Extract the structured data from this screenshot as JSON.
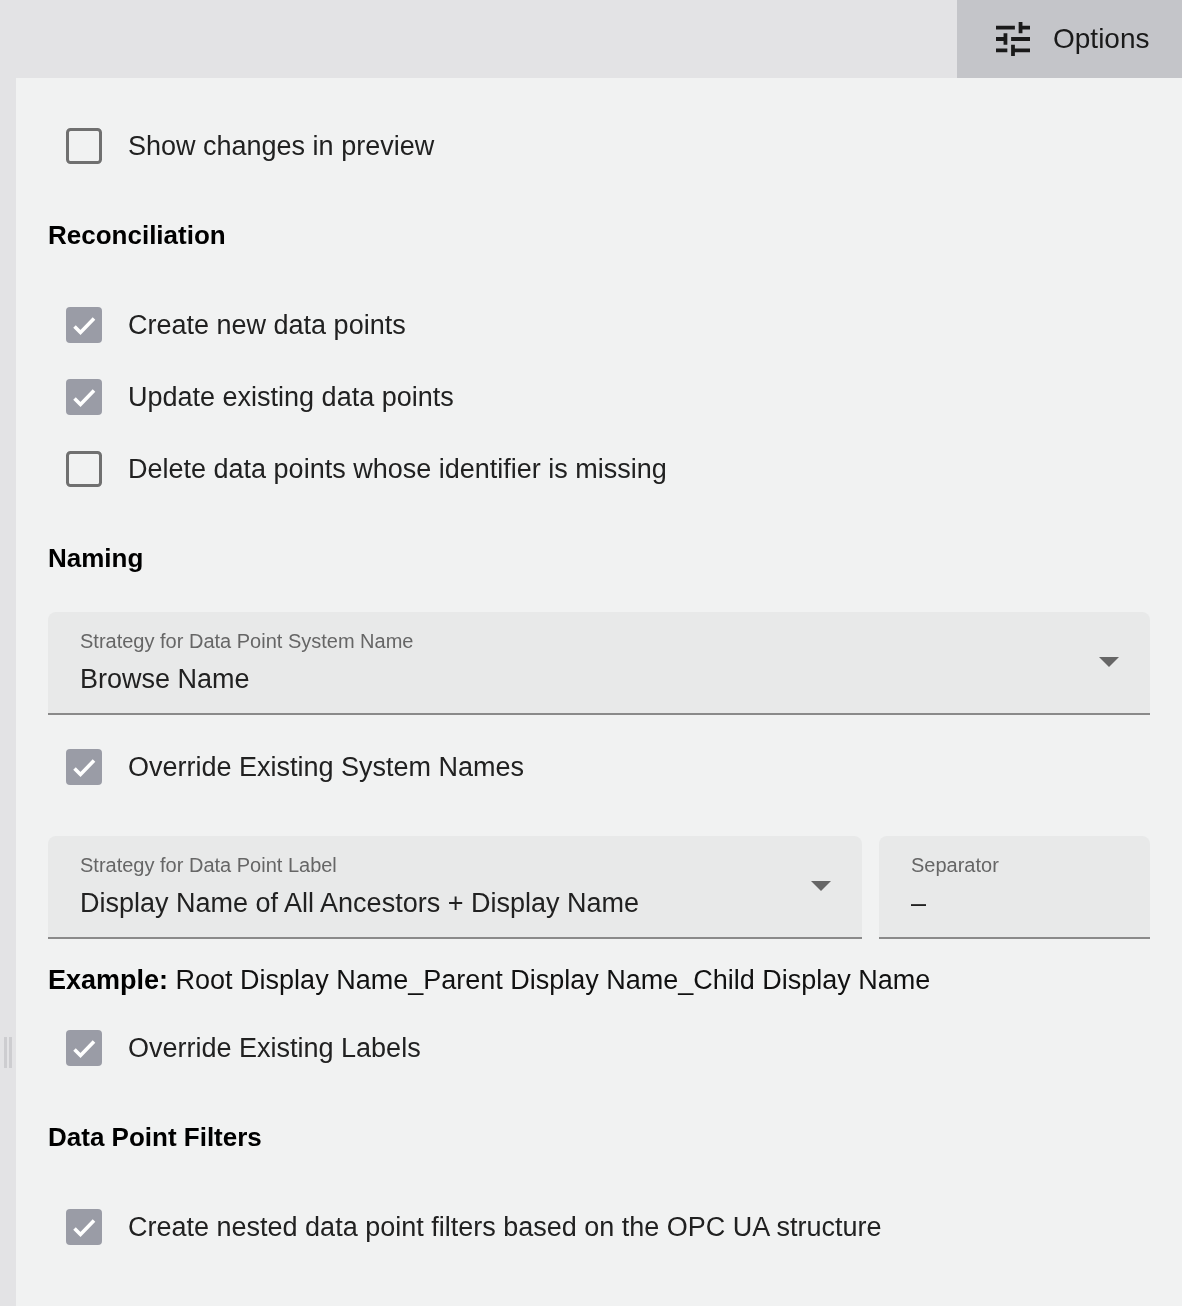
{
  "toolbar": {
    "options_button": {
      "label": "Options"
    }
  },
  "preview_toggle": {
    "label": "Show changes in preview",
    "checked": false
  },
  "sections": [
    {
      "title": "Reconciliation",
      "items": [
        {
          "kind": "checkbox",
          "label": "Create new data points",
          "checked": true
        },
        {
          "kind": "checkbox",
          "label": "Update existing data points",
          "checked": true
        },
        {
          "kind": "checkbox",
          "label": "Delete data points whose identifier is missing",
          "checked": false
        }
      ]
    },
    {
      "title": "Naming",
      "items": [
        {
          "kind": "select",
          "label": "Strategy for Data Point System Name",
          "value": "Browse Name"
        },
        {
          "kind": "checkbox",
          "label": "Override Existing System Names",
          "checked": true
        },
        {
          "kind": "field_row",
          "fields": [
            {
              "kind": "select",
              "label": "Strategy for Data Point Label",
              "value": "Display Name of All Ancestors + Display Name"
            },
            {
              "kind": "text",
              "label": "Separator",
              "value": "–"
            }
          ]
        },
        {
          "kind": "example",
          "text": "**Example:** Root Display Name_Parent Display Name_Child Display Name"
        },
        {
          "kind": "checkbox",
          "label": "Override Existing Labels",
          "checked": true
        }
      ]
    },
    {
      "title": "Data Point Filters",
      "items": [
        {
          "kind": "checkbox",
          "label": "Create nested data point filters based on the OPC UA structure",
          "checked": true
        }
      ]
    }
  ]
}
